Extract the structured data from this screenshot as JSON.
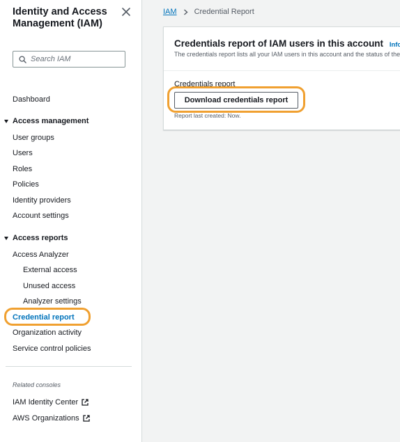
{
  "sidebar": {
    "title": "Identity and Access Management (IAM)",
    "search_placeholder": "Search IAM",
    "dashboard": "Dashboard",
    "access_management": {
      "label": "Access management",
      "items": [
        "User groups",
        "Users",
        "Roles",
        "Policies",
        "Identity providers",
        "Account settings"
      ]
    },
    "access_reports": {
      "label": "Access reports",
      "access_analyzer": "Access Analyzer",
      "analyzer_items": [
        "External access",
        "Unused access",
        "Analyzer settings"
      ],
      "credential_report": "Credential report",
      "organization_activity": "Organization activity",
      "scp": "Service control policies"
    },
    "related_consoles": {
      "label": "Related consoles",
      "items": [
        "IAM Identity Center",
        "AWS Organizations"
      ]
    }
  },
  "breadcrumb": {
    "root": "IAM",
    "current": "Credential Report"
  },
  "card": {
    "title": "Credentials report of IAM users in this account",
    "info": "Info",
    "description": "The credentials report lists all your IAM users in this account and the status of their various credentials.",
    "section_label": "Credentials report",
    "download_button": "Download credentials report",
    "last_created": "Report last created: Now."
  },
  "colors": {
    "link": "#0073bb",
    "highlight": "#f0a030",
    "border": "#d5dbdb",
    "background": "#f2f3f3"
  },
  "icons": {
    "close": "close-icon",
    "search": "search-icon",
    "breadcrumb_separator": "chevron-right-icon",
    "external_link": "external-link-icon",
    "section_toggle": "caret-down-icon"
  }
}
